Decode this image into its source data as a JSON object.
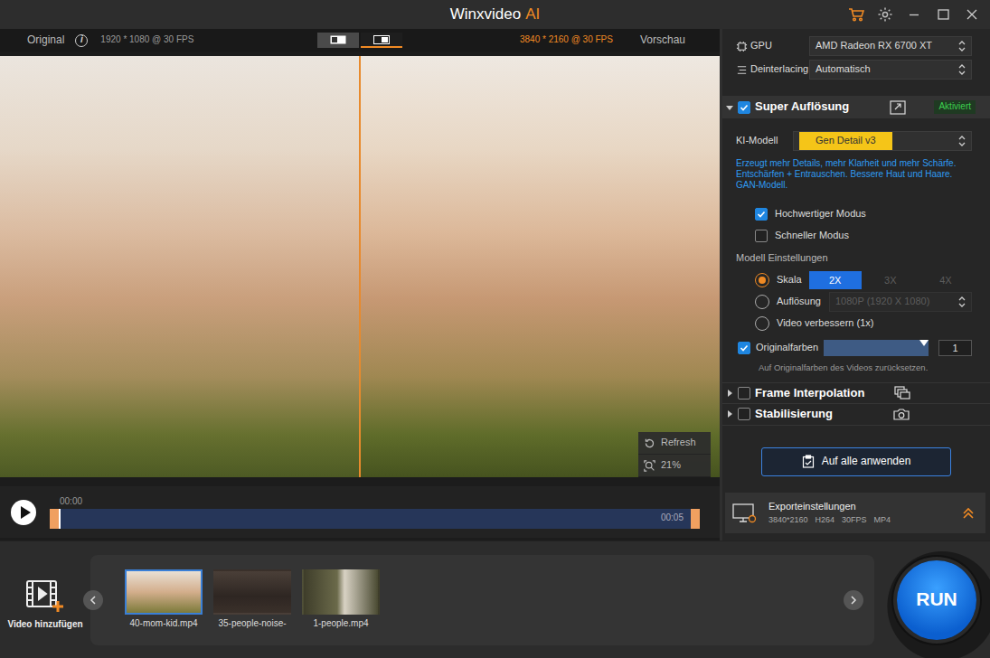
{
  "window": {
    "title": "Winxvideo",
    "title_accent": "AI"
  },
  "preview": {
    "original_label": "Original",
    "info_icon": "i",
    "original_resolution": "1920 * 1080 @ 30 FPS",
    "view_modes": [
      {
        "kind": "side-by-side",
        "selected": false
      },
      {
        "kind": "split",
        "selected": true
      }
    ],
    "output_resolution": "3840 * 2160 @ 30 FPS",
    "preview_label": "Vorschau",
    "refresh": "Refresh",
    "zoom": "21%"
  },
  "timeline": {
    "start": "00:00",
    "end": "00:05",
    "level": 0
  },
  "settings": {
    "gpu": {
      "label": "GPU",
      "value": "AMD Radeon RX 6700 XT"
    },
    "deinterlacing": {
      "label": "Deinterlacing",
      "value": "Automatisch"
    },
    "super_resolution": {
      "title": "Super Auflösung",
      "checked": true,
      "expanded": true,
      "badge": "Aktiviert",
      "model_label": "KI-Modell",
      "model": "Gen Detail v3",
      "description": "Erzeugt mehr Details, mehr Klarheit und mehr Schärfe. Entschärfen + Entrauschen. Bessere Haut und Haare. GAN-Modell.",
      "modes": [
        {
          "label": "Hochwertiger Modus",
          "checked": true
        },
        {
          "label": "Schneller Modus",
          "checked": false
        }
      ],
      "settings_title": "Modell Einstellungen",
      "options": [
        {
          "kind": "scale",
          "label": "Skala",
          "selected": true,
          "choices": [
            {
              "label": "2X",
              "selected": true,
              "disabled": false
            },
            {
              "label": "3X",
              "selected": false,
              "disabled": true
            },
            {
              "label": "4X",
              "selected": false,
              "disabled": true
            }
          ]
        },
        {
          "kind": "select",
          "label": "Auflösung",
          "selected": false,
          "value": "1080P (1920 X 1080)",
          "disabled": true
        },
        {
          "kind": "plain",
          "label": "Video verbessern (1x)",
          "selected": false
        }
      ],
      "original_colors": {
        "label": "Originalfarben",
        "checked": true,
        "level": 1,
        "value": "1",
        "hint": "Auf Originalfarben des Videos zurücksetzen."
      }
    },
    "collapsed_sections": [
      {
        "kind": "frames",
        "title": "Frame Interpolation",
        "checked": false,
        "expanded": false
      },
      {
        "kind": "camera",
        "title": "Stabilisierung",
        "checked": false,
        "expanded": false
      }
    ],
    "apply_all": "Auf alle anwenden",
    "export": {
      "title": "Exporteinstellungen",
      "details": [
        "3840*2160",
        "H264",
        "30FPS",
        "MP4"
      ]
    }
  },
  "files": {
    "add_label": "Video hinzufügen",
    "items": [
      {
        "label": "40-mom-kid.mp4",
        "selected": true
      },
      {
        "label": "35-people-noise-",
        "selected": false
      },
      {
        "label": "1-people.mp4",
        "selected": false
      }
    ]
  },
  "run": "RUN"
}
